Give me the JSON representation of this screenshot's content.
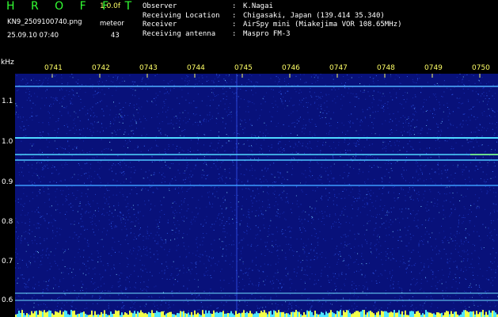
{
  "header": {
    "title": "H R O F F T",
    "version": "1.0.0f",
    "filename": "KN9_2509100740.png",
    "datetime": "25.09.10 07:40",
    "meteor_label": "meteor",
    "meteor_count": "43"
  },
  "info": [
    {
      "key": "Observer",
      "sep": ":",
      "value": "K.Nagai"
    },
    {
      "key": "Receiving Location",
      "sep": ":",
      "value": "Chigasaki, Japan (139.414 35.340)"
    },
    {
      "key": "Receiver",
      "sep": ":",
      "value": "AirSpy mini (Miakejima VOR 108.65MHz)"
    },
    {
      "key": "Receiving antenna",
      "sep": ":",
      "value": "Maspro FM-3"
    }
  ],
  "axes": {
    "y_unit": "kHz",
    "y_ticks": [
      "1.1",
      "1.0",
      "0.9",
      "0.8",
      "0.7",
      "0.6"
    ],
    "x_ticks": [
      "0741",
      "0742",
      "0743",
      "0744",
      "0745",
      "0746",
      "0747",
      "0748",
      "0749",
      "0750"
    ]
  },
  "colors": {
    "background": "#08117a",
    "title": "#33ff33",
    "tick_label": "#ffff66",
    "trace": "#4fd8ff"
  }
}
